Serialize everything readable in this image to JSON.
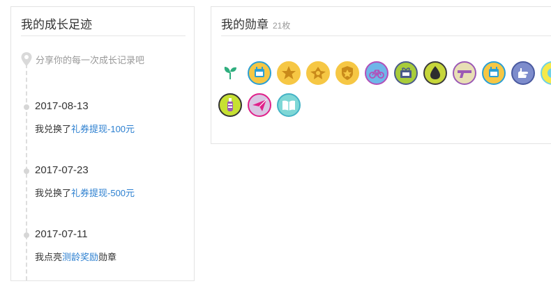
{
  "growth": {
    "title": "我的成长足迹",
    "share_hint": "分享你的每一次成长记录吧",
    "entries": [
      {
        "date": "2017-08-13",
        "prefix": "我兑换了",
        "link": "礼券提现-100元",
        "suffix": ""
      },
      {
        "date": "2017-07-23",
        "prefix": "我兑换了",
        "link": "礼券提现-500元",
        "suffix": ""
      },
      {
        "date": "2017-07-11",
        "prefix": "我点亮",
        "link": "测龄奖励",
        "suffix": "勋章"
      }
    ]
  },
  "medals": {
    "title": "我的勋章",
    "count": "21枚",
    "items": [
      {
        "icon": "sprout-badge",
        "bg": "#ffffff",
        "border": "#ffffff",
        "fg": "#2fae7e"
      },
      {
        "icon": "calendar-badge",
        "bg": "#f6c744",
        "border": "#2a9fd6",
        "fg": "#2a9fd6"
      },
      {
        "icon": "star-shield-badge",
        "bg": "#f6c744",
        "border": "#f6c744",
        "fg": "#c98a1a"
      },
      {
        "icon": "wings-badge",
        "bg": "#f6c744",
        "border": "#f6c744",
        "fg": "#c98a1a"
      },
      {
        "icon": "shield-badge",
        "bg": "#f6c744",
        "border": "#f6c744",
        "fg": "#c98a1a"
      },
      {
        "icon": "bicycle-badge",
        "bg": "#6fb6e9",
        "border": "#b34fb8",
        "fg": "#b34fb8"
      },
      {
        "icon": "gift-badge",
        "bg": "#a8cc3a",
        "border": "#4a5a8a",
        "fg": "#4a5a8a"
      },
      {
        "icon": "drop-badge",
        "bg": "#c6d63a",
        "border": "#3b3b3b",
        "fg": "#2e2e2e"
      },
      {
        "icon": "gun-badge",
        "bg": "#e8dfb4",
        "border": "#9b59b6",
        "fg": "#9b59b6"
      },
      {
        "icon": "calendar-badge",
        "bg": "#f6c744",
        "border": "#2a9fd6",
        "fg": "#2a9fd6"
      },
      {
        "icon": "hand-badge",
        "bg": "#7d8ccc",
        "border": "#4a5aa0",
        "fg": "#ffffff"
      },
      {
        "icon": "partial-badge",
        "bg": "#f6e94a",
        "border": "#6fd1e6",
        "fg": "#6fd1e6"
      },
      {
        "icon": "bottle-badge",
        "bg": "#c6e033",
        "border": "#333333",
        "fg": "#9b59b6"
      },
      {
        "icon": "paper-plane-badge",
        "bg": "#d9c7e3",
        "border": "#e0218a",
        "fg": "#e0218a"
      },
      {
        "icon": "book-badge",
        "bg": "#7ed7d6",
        "border": "#45b3c6",
        "fg": "#ffffff"
      }
    ]
  }
}
